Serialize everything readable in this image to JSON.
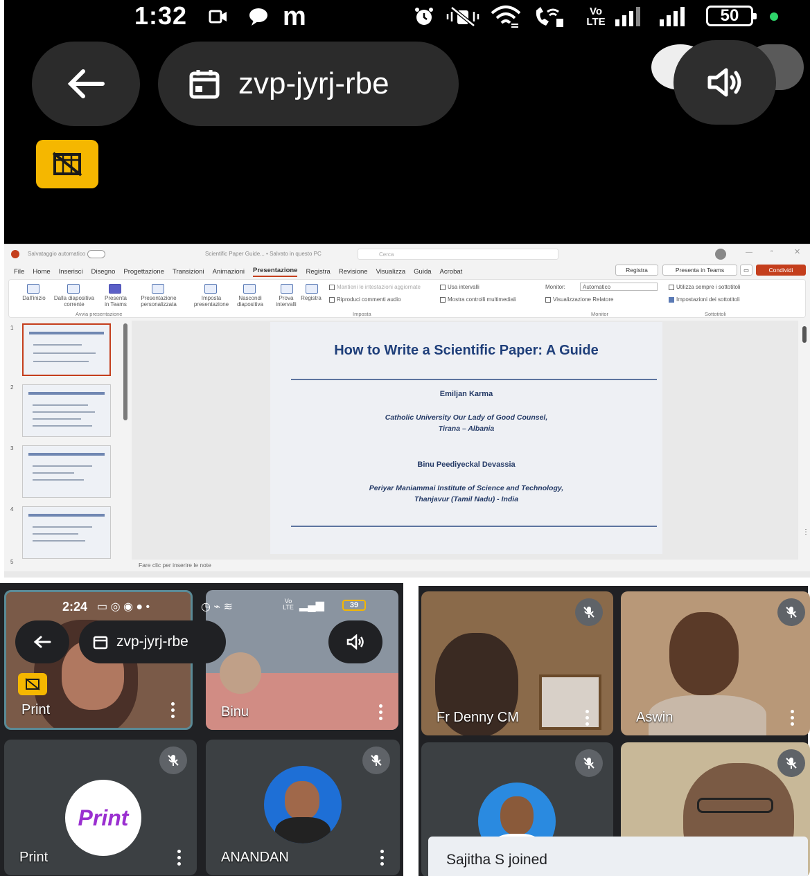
{
  "status_bar": {
    "time": "1:32",
    "m_glyph": "m",
    "network_label": "Vo LTE",
    "battery": "50"
  },
  "meeting": {
    "code": "zvp-jyrj-rbe"
  },
  "powerpoint": {
    "autosave": "Salvataggio automatico",
    "doc_title": "Scientific Paper Guide... • Salvato in questo PC",
    "search_placeholder": "Cerca",
    "menu": [
      "File",
      "Home",
      "Inserisci",
      "Disegno",
      "Progettazione",
      "Transizioni",
      "Animazioni",
      "Presentazione",
      "Registra",
      "Revisione",
      "Visualizza",
      "Guida",
      "Acrobat"
    ],
    "active_menu": "Presentazione",
    "btn_registra": "Registra",
    "btn_teams": "Presenta in Teams",
    "btn_share": "Condividi",
    "ribbon": {
      "b1": "Dall'inizio",
      "b2": "Dalla diapositiva corrente",
      "b3": "Presenta in Teams",
      "b4": "Presentazione personalizzata",
      "g1": "Avvia presentazione",
      "b5": "Imposta presentazione",
      "b6": "Nascondi diapositiva",
      "b7": "Prova intervalli",
      "b8": "Registra",
      "c1": "Mantieni le intestazioni aggiornate",
      "c2": "Usa intervalli",
      "c3": "Riproduci commenti audio",
      "c4": "Mostra controlli multimediali",
      "g2": "Imposta",
      "m1": "Monitor:",
      "m1v": "Automatico",
      "m2": "Visualizzazione Relatore",
      "g3": "Monitor",
      "s1": "Utilizza sempre i sottotitoli",
      "s2": "Impostazioni dei sottotitoli",
      "g4": "Sottotitoli"
    },
    "thumbs": [
      "1",
      "2",
      "3",
      "4",
      "5"
    ],
    "slide": {
      "title": "How to Write a Scientific Paper: A Guide",
      "author1": "Emiljan Karma",
      "aff1_line1": "Catholic University Our Lady of Good Counsel,",
      "aff1_line2": "Tirana – Albania",
      "author2": "Binu Peediyeckal Devassia",
      "aff2_line1": "Periyar Maniammai Institute of Science and Technology,",
      "aff2_line2": "Thanjavur (Tamil Nadu) - India"
    },
    "notes_placeholder": "Fare clic per inserire le note"
  },
  "left_call": {
    "status_time": "2:24",
    "network_label": "Vo LTE",
    "battery": "39",
    "meeting_code": "zvp-jyrj-rbe",
    "tiles": [
      {
        "name": "Print"
      },
      {
        "name": "Binu"
      },
      {
        "name": "Print"
      },
      {
        "name": "ANANDAN"
      }
    ],
    "avatar_logo_text": "Print"
  },
  "right_call": {
    "tiles": [
      {
        "name": "Fr Denny CM"
      },
      {
        "name": "Aswin"
      },
      {
        "name": ""
      },
      {
        "name": ""
      }
    ],
    "toast": "Sajitha S joined"
  },
  "colors": {
    "accent_orange": "#c43e1c",
    "slide_blue": "#1f3f7a",
    "meet_dark": "#202124",
    "cam_off_yellow": "#f5b700"
  }
}
